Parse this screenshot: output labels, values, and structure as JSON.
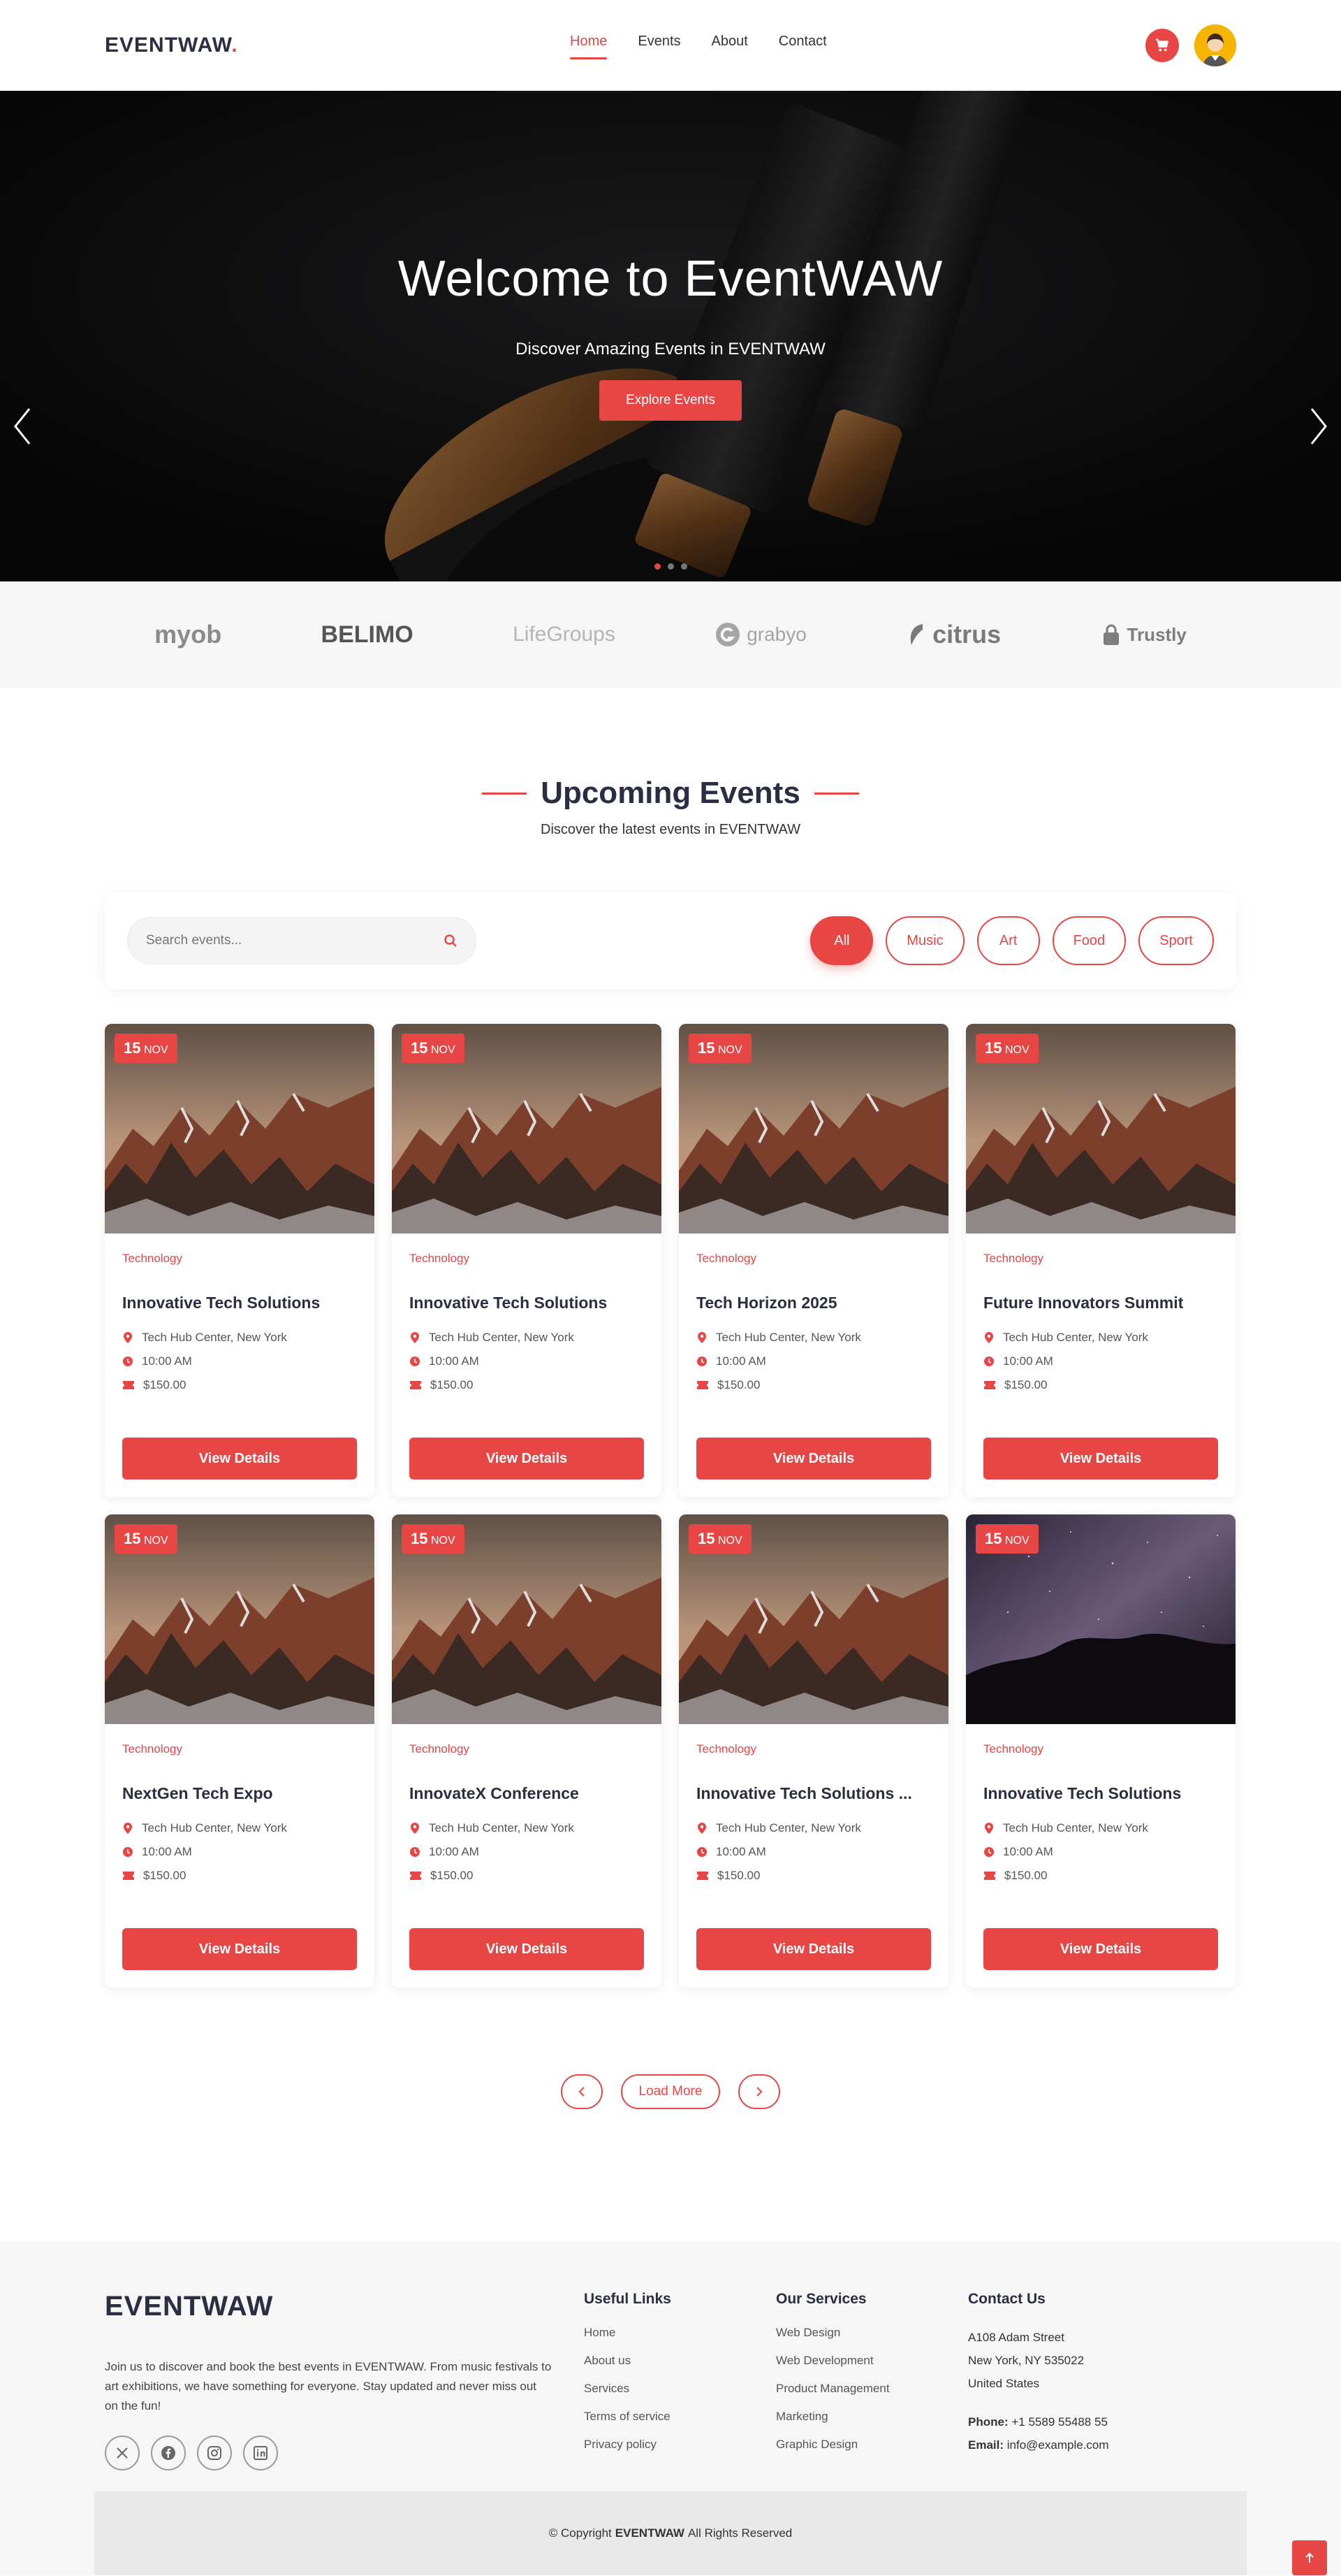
{
  "header": {
    "logo": "EVENTWAW",
    "logo_dot": ".",
    "nav": [
      {
        "label": "Home",
        "active": true
      },
      {
        "label": "Events",
        "active": false
      },
      {
        "label": "About",
        "active": false
      },
      {
        "label": "Contact",
        "active": false
      }
    ],
    "cart_icon": "cart-icon",
    "avatar_icon": "user-avatar"
  },
  "hero": {
    "title": "Welcome to EventWAW",
    "subtitle": "Discover Amazing Events in EVENTWAW",
    "button": "Explore Events",
    "slide_count": 3,
    "active_slide": 0
  },
  "clients": [
    "myob",
    "BELIMO",
    "LifeGroups",
    "grabyo",
    "citrus",
    "Trustly"
  ],
  "events_section": {
    "title": "Upcoming Events",
    "subtitle": "Discover the latest events in EVENTWAW",
    "search_placeholder": "Search events...",
    "filters": [
      "All",
      "Music",
      "Art",
      "Food",
      "Sport"
    ],
    "active_filter": "All",
    "events": [
      {
        "day": "15",
        "month": "NOV",
        "category": "Technology",
        "title": "Innovative Tech Solutions",
        "location": "Tech Hub Center, New York",
        "time": "10:00 AM",
        "price": "$150.00",
        "image": "mountains"
      },
      {
        "day": "15",
        "month": "NOV",
        "category": "Technology",
        "title": "Innovative Tech Solutions",
        "location": "Tech Hub Center, New York",
        "time": "10:00 AM",
        "price": "$150.00",
        "image": "mountains"
      },
      {
        "day": "15",
        "month": "NOV",
        "category": "Technology",
        "title": "Tech Horizon 2025",
        "location": "Tech Hub Center, New York",
        "time": "10:00 AM",
        "price": "$150.00",
        "image": "mountains"
      },
      {
        "day": "15",
        "month": "NOV",
        "category": "Technology",
        "title": "Future Innovators Summit",
        "location": "Tech Hub Center, New York",
        "time": "10:00 AM",
        "price": "$150.00",
        "image": "mountains"
      },
      {
        "day": "15",
        "month": "NOV",
        "category": "Technology",
        "title": "NextGen Tech Expo",
        "location": "Tech Hub Center, New York",
        "time": "10:00 AM",
        "price": "$150.00",
        "image": "mountains"
      },
      {
        "day": "15",
        "month": "NOV",
        "category": "Technology",
        "title": "InnovateX Conference",
        "location": "Tech Hub Center, New York",
        "time": "10:00 AM",
        "price": "$150.00",
        "image": "mountains"
      },
      {
        "day": "15",
        "month": "NOV",
        "category": "Technology",
        "title": "Innovative Tech Solutions ...",
        "location": "Tech Hub Center, New York",
        "time": "10:00 AM",
        "price": "$150.00",
        "image": "mountains"
      },
      {
        "day": "15",
        "month": "NOV",
        "category": "Technology",
        "title": "Innovative Tech Solutions",
        "location": "Tech Hub Center, New York",
        "time": "10:00 AM",
        "price": "$150.00",
        "image": "night-sky"
      }
    ],
    "view_details_label": "View Details",
    "load_more_label": "Load More"
  },
  "footer": {
    "logo": "EVENTWAW",
    "about": "Join us to discover and book the best events in EVENTWAW. From music festivals to art exhibitions, we have something for everyone. Stay updated and never miss out on the fun!",
    "socials": [
      "x-icon",
      "facebook-icon",
      "instagram-icon",
      "linkedin-icon"
    ],
    "useful_links": {
      "title": "Useful Links",
      "items": [
        "Home",
        "About us",
        "Services",
        "Terms of service",
        "Privacy policy"
      ]
    },
    "services": {
      "title": "Our Services",
      "items": [
        "Web Design",
        "Web Development",
        "Product Management",
        "Marketing",
        "Graphic Design"
      ]
    },
    "contact": {
      "title": "Contact Us",
      "address1": "A108 Adam Street",
      "address2": "New York, NY 535022",
      "address3": "United States",
      "phone_label": "Phone:",
      "phone": "+1 5589 55488 55",
      "email_label": "Email:",
      "email": "info@example.com"
    },
    "copyright_prefix": "© Copyright",
    "copyright_brand": "EVENTWAW",
    "copyright_suffix": "All Rights Reserved"
  },
  "colors": {
    "accent": "#e84545",
    "dark": "#2b2d42",
    "footer_bg": "#f6f6f6"
  }
}
